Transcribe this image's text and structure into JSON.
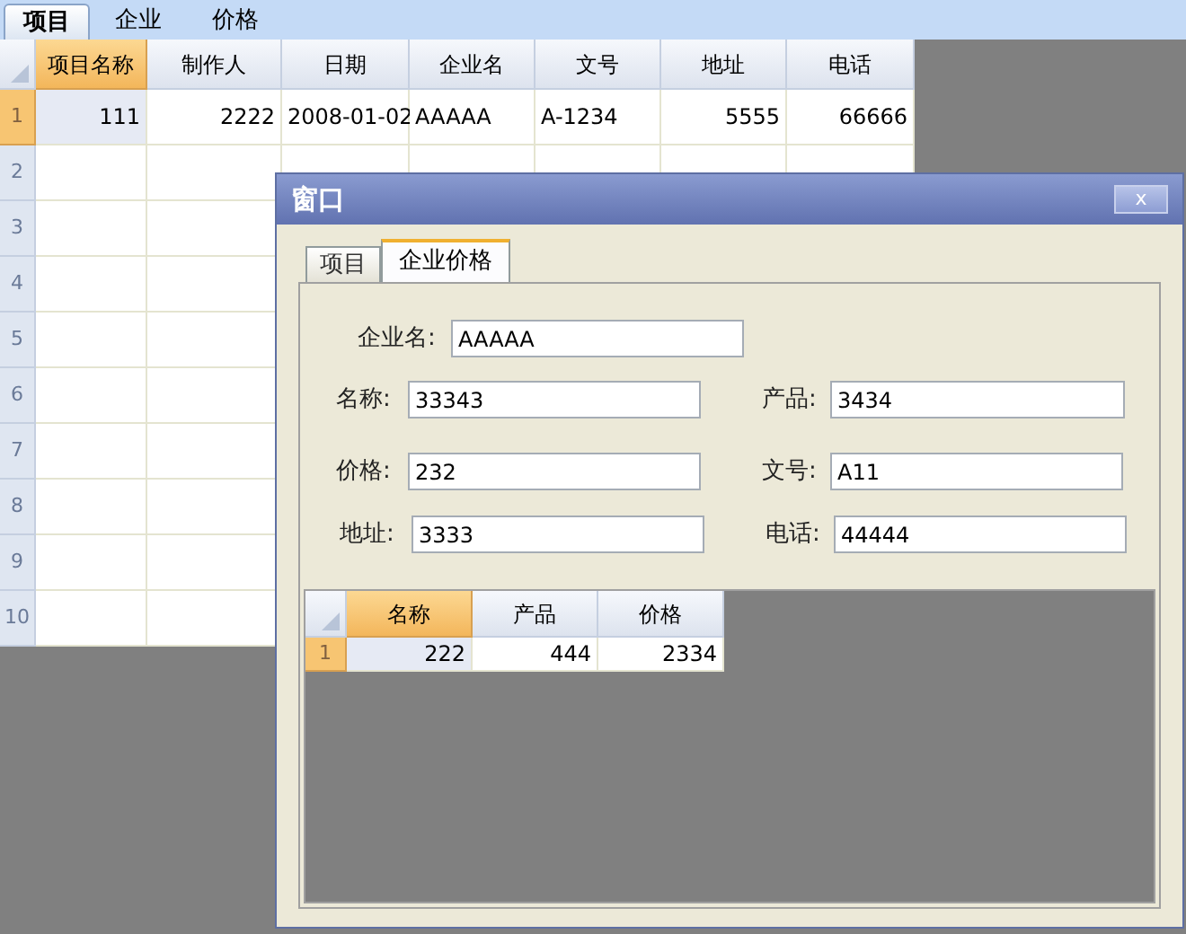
{
  "tabs": [
    {
      "label": "项目",
      "selected": true
    },
    {
      "label": "企业",
      "selected": false
    },
    {
      "label": "价格",
      "selected": false
    }
  ],
  "grid": {
    "columns": [
      {
        "label": "项目名称",
        "selected": true,
        "kind": "number"
      },
      {
        "label": "制作人",
        "selected": false,
        "kind": "number"
      },
      {
        "label": "日期",
        "selected": false,
        "kind": "text"
      },
      {
        "label": "企业名",
        "selected": false,
        "kind": "text"
      },
      {
        "label": "文号",
        "selected": false,
        "kind": "text"
      },
      {
        "label": "地址",
        "selected": false,
        "kind": "number"
      },
      {
        "label": "电话",
        "selected": false,
        "kind": "number"
      }
    ],
    "rows": [
      {
        "number": "1",
        "selected": true,
        "cells": [
          "111",
          "2222",
          "2008-01-02",
          "AAAAA",
          "A-1234",
          "5555",
          "66666"
        ]
      },
      {
        "number": "2",
        "selected": false
      },
      {
        "number": "3",
        "selected": false
      },
      {
        "number": "4",
        "selected": false
      },
      {
        "number": "5",
        "selected": false
      },
      {
        "number": "6",
        "selected": false
      },
      {
        "number": "7",
        "selected": false
      },
      {
        "number": "8",
        "selected": false
      },
      {
        "number": "9",
        "selected": false
      },
      {
        "number": "10",
        "selected": false
      }
    ]
  },
  "dialog": {
    "title": "窗口",
    "close": "x",
    "tabs": [
      {
        "label": "项目",
        "selected": false
      },
      {
        "label": "企业价格",
        "selected": true
      }
    ],
    "form": [
      [
        {
          "label": "企业名:",
          "value": "AAAAA"
        }
      ],
      [
        {
          "label": "名称:",
          "value": "33343"
        },
        {
          "label": "产品:",
          "value": "3434"
        }
      ],
      [
        {
          "label": "价格:",
          "value": "232"
        },
        {
          "label": "文号:",
          "value": "A11"
        }
      ],
      [
        {
          "label": "地址:",
          "value": "3333"
        },
        {
          "label": "电话:",
          "value": "44444"
        }
      ]
    ],
    "grid": {
      "columns": [
        {
          "label": "名称",
          "selected": true
        },
        {
          "label": "产品",
          "selected": false
        },
        {
          "label": "价格",
          "selected": false
        }
      ],
      "rows": [
        {
          "number": "1",
          "selected": true,
          "cells": [
            "222",
            "444",
            "2334"
          ]
        }
      ]
    }
  }
}
